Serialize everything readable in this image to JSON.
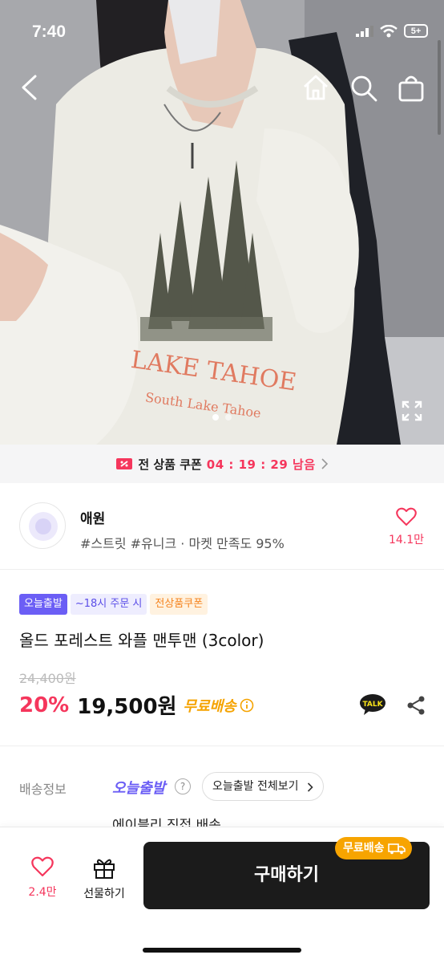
{
  "status": {
    "time": "7:40",
    "battery": "5+"
  },
  "hero": {
    "alt_icons": [
      "back-icon",
      "home-icon",
      "search-icon",
      "bag-icon",
      "expand-icon"
    ],
    "slide_count": 2,
    "active_slide": 1,
    "shirt_print_line1": "LAKE TAHOE",
    "shirt_print_line2": "South Lake Tahoe"
  },
  "coupon": {
    "label": "전 상품 쿠폰",
    "timer": "04 : 19 : 29 남음"
  },
  "store": {
    "name": "애원",
    "tags": "#스트릿 #유니크 · 마켓 만족도 95%",
    "like_count": "14.1만"
  },
  "product": {
    "badges": {
      "today": "오늘출발",
      "order": "~18시 주문 시",
      "coupon": "전상품쿠폰"
    },
    "title": "올드 포레스트 와플 맨투맨 (3color)",
    "original_price": "24,400원",
    "discount": "20%",
    "price": "19,500원",
    "free_shipping": "무료배송",
    "talk_label": "TALK"
  },
  "delivery": {
    "label": "배송정보",
    "today": "오늘출발",
    "help": "?",
    "view_all": "오늘출발 전체보기",
    "sub": "에이블리 직접 배송"
  },
  "bottom": {
    "like_count": "2.4만",
    "gift_label": "선물하기",
    "buy_label": "구매하기",
    "free_ship_tag": "무료배송"
  },
  "colors": {
    "accent": "#f5365c",
    "purple": "#6b5ef5",
    "orange": "#f7a400",
    "dark": "#1b1b1b"
  }
}
